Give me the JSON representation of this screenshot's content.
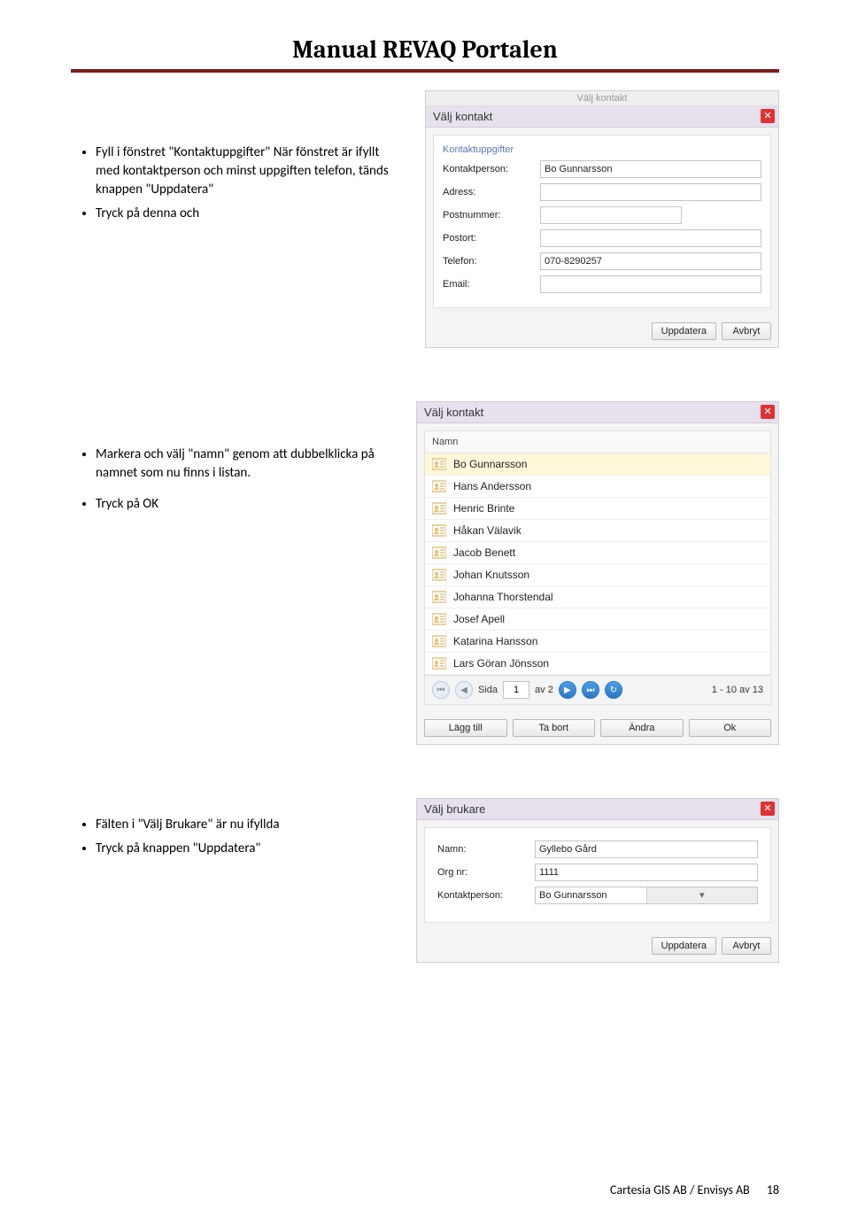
{
  "doc": {
    "title": "Manual REVAQ Portalen",
    "footer": "Cartesia GIS AB  / Envisys AB",
    "page_number": "18"
  },
  "section1": {
    "bullets": [
      "Fyll i fönstret \"Kontaktuppgifter\" När fönstret är ifyllt med kontaktperson och minst uppgiften telefon, tänds knappen \"Uppdatera\"",
      "Tryck på denna och"
    ],
    "ghost": "Välj kontakt",
    "title": "Välj kontakt",
    "fieldset": "Kontaktuppgifter",
    "fields": {
      "kontaktperson_label": "Kontaktperson:",
      "kontaktperson_value": "Bo Gunnarsson",
      "adress_label": "Adress:",
      "adress_value": "",
      "postnummer_label": "Postnummer:",
      "postnummer_value": "",
      "postort_label": "Postort:",
      "postort_value": "",
      "telefon_label": "Telefon:",
      "telefon_value": "070-8290257",
      "email_label": "Email:",
      "email_value": ""
    },
    "btn_update": "Uppdatera",
    "btn_cancel": "Avbryt"
  },
  "section2": {
    "bullets": [
      "Markera och välj   \"namn\" genom att dubbelklicka på namnet som nu finns i listan.",
      "Tryck på OK"
    ],
    "title": "Välj kontakt",
    "header": "Namn",
    "names": [
      "Bo Gunnarsson",
      "Hans Andersson",
      "Henric Brinte",
      "Håkan Välavik",
      "Jacob Benett",
      "Johan Knutsson",
      "Johanna Thorstendal",
      "Josef Apell",
      "Katarina Hansson",
      "Lars Göran Jönsson"
    ],
    "pager": {
      "sida": "Sida",
      "page": "1",
      "av": "av 2",
      "range": "1 - 10 av 13"
    },
    "btn_add": "Lägg till",
    "btn_remove": "Ta bort",
    "btn_edit": "Ändra",
    "btn_ok": "Ok"
  },
  "section3": {
    "bullets": [
      "Fälten i  \"Välj Brukare\" är nu ifyllda",
      "Tryck på knappen  \"Uppdatera\""
    ],
    "title": "Välj brukare",
    "fields": {
      "namn_label": "Namn:",
      "namn_value": "Gyllebo Gård",
      "orgnr_label": "Org nr:",
      "orgnr_value": "1111",
      "kontakt_label": "Kontaktperson:",
      "kontakt_value": "Bo Gunnarsson"
    },
    "btn_update": "Uppdatera",
    "btn_cancel": "Avbryt"
  }
}
